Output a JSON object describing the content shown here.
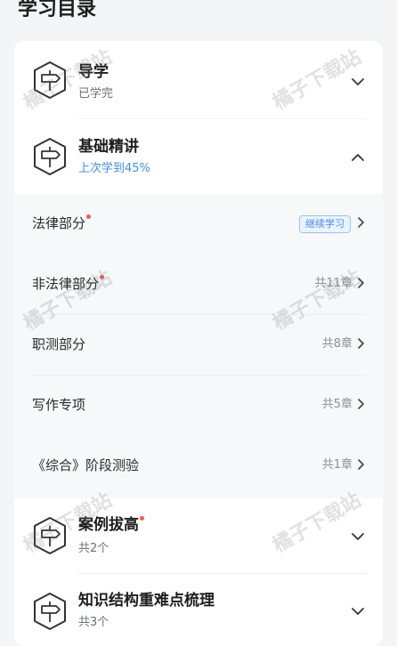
{
  "page": {
    "title": "学习目录"
  },
  "sections": [
    {
      "title": "导学",
      "sub": "已学完",
      "icon": "signpost-icon",
      "expanded": false
    },
    {
      "title": "基础精讲",
      "sub": "上次学到45%",
      "icon": "signpost-icon",
      "expanded": true
    },
    {
      "title": "案例拔高",
      "sub": "共2个",
      "icon": "signpost-icon",
      "expanded": false,
      "dot": true
    },
    {
      "title": "知识结构重难点梳理",
      "sub": "共3个",
      "icon": "signpost-icon",
      "expanded": false
    }
  ],
  "sub_items": [
    {
      "label": "法律部分",
      "dot": true,
      "badge": "继续学习"
    },
    {
      "label": "非法律部分",
      "dot": true,
      "count": "共11章"
    },
    {
      "label": "职测部分",
      "count": "共8章"
    },
    {
      "label": "写作专项",
      "count": "共5章"
    },
    {
      "label": "《综合》阶段测验",
      "count": "共1章"
    }
  ],
  "watermark": "橘子下载站",
  "colors": {
    "accent": "#3e8ef7",
    "dot": "#f25a4a",
    "background": "#f4f5f7"
  }
}
